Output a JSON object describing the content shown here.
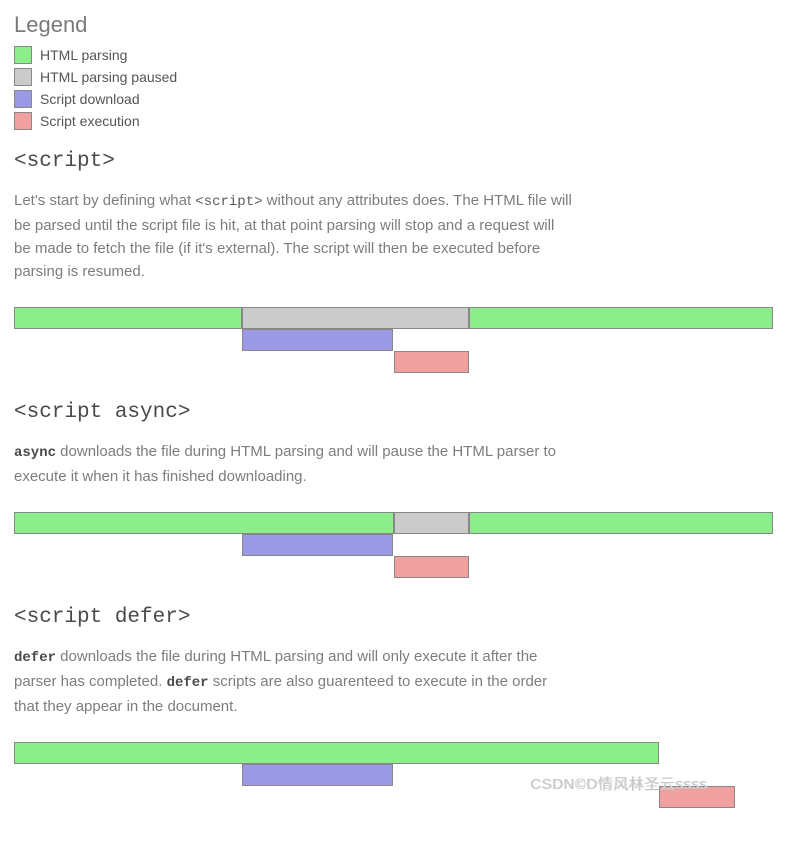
{
  "legend": {
    "title": "Legend",
    "items": [
      {
        "label": "HTML parsing",
        "color": "#8BEE8B"
      },
      {
        "label": "HTML parsing paused",
        "color": "#CBCBCB"
      },
      {
        "label": "Script download",
        "color": "#9999E5"
      },
      {
        "label": "Script execution",
        "color": "#F1A0A0"
      }
    ]
  },
  "colors": {
    "parsing": "#8BEE8B",
    "paused": "#CBCBCB",
    "download": "#9999E5",
    "execution": "#F1A0A0"
  },
  "sections": [
    {
      "heading": "<script>",
      "body_pre": "Let's start by defining what ",
      "body_code": "<script>",
      "body_post": " without any attributes does. The HTML file will be parsed until the script file is hit, at that point parsing will stop and a request will be made to fetch the file (if it's external). The script will then be executed before parsing is resumed."
    },
    {
      "heading": "<script async>",
      "body_bold1": "async",
      "body_rest": " downloads the file during HTML parsing and will pause the HTML parser to execute it when it has finished downloading."
    },
    {
      "heading": "<script defer>",
      "body_bold1": "defer",
      "body_mid": " downloads the file during HTML parsing and will only execute it after the parser has completed. ",
      "body_bold2": "defer",
      "body_rest": " scripts are also guarenteed to execute in the order that they appear in the document."
    }
  ],
  "chart_data": [
    {
      "type": "bar",
      "title": "<script>",
      "xlim": [
        0,
        100
      ],
      "rows": [
        {
          "name": "html",
          "segments": [
            {
              "kind": "parsing",
              "start": 0,
              "end": 30
            },
            {
              "kind": "paused",
              "start": 30,
              "end": 60
            },
            {
              "kind": "parsing",
              "start": 60,
              "end": 100
            }
          ]
        },
        {
          "name": "download",
          "segments": [
            {
              "kind": "download",
              "start": 30,
              "end": 50
            }
          ]
        },
        {
          "name": "execution",
          "segments": [
            {
              "kind": "execution",
              "start": 50,
              "end": 60
            }
          ]
        }
      ]
    },
    {
      "type": "bar",
      "title": "<script async>",
      "xlim": [
        0,
        100
      ],
      "rows": [
        {
          "name": "html",
          "segments": [
            {
              "kind": "parsing",
              "start": 0,
              "end": 50
            },
            {
              "kind": "paused",
              "start": 50,
              "end": 60
            },
            {
              "kind": "parsing",
              "start": 60,
              "end": 100
            }
          ]
        },
        {
          "name": "download",
          "segments": [
            {
              "kind": "download",
              "start": 30,
              "end": 50
            }
          ]
        },
        {
          "name": "execution",
          "segments": [
            {
              "kind": "execution",
              "start": 50,
              "end": 60
            }
          ]
        }
      ]
    },
    {
      "type": "bar",
      "title": "<script defer>",
      "xlim": [
        0,
        100
      ],
      "rows": [
        {
          "name": "html",
          "segments": [
            {
              "kind": "parsing",
              "start": 0,
              "end": 85
            }
          ]
        },
        {
          "name": "download",
          "segments": [
            {
              "kind": "download",
              "start": 30,
              "end": 50
            }
          ]
        },
        {
          "name": "execution",
          "segments": [
            {
              "kind": "execution",
              "start": 85,
              "end": 95
            }
          ]
        }
      ]
    }
  ],
  "watermark": "CSDN©D情风林圣云ssss"
}
